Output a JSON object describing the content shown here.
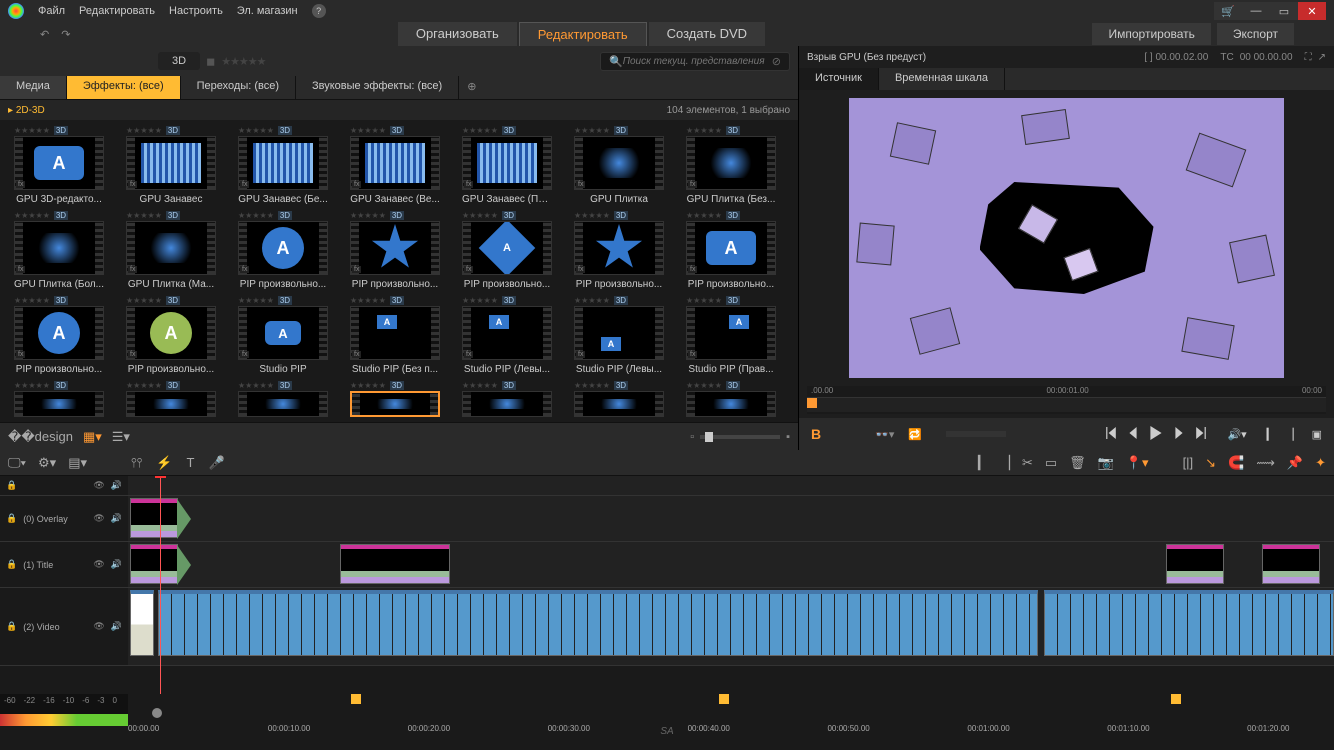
{
  "menu": {
    "file": "Файл",
    "edit": "Редактировать",
    "setup": "Настроить",
    "eshop": "Эл. магазин"
  },
  "modes": {
    "organize": "Организовать",
    "edit": "Редактировать",
    "createdvd": "Создать DVD"
  },
  "topRight": {
    "import": "Импортировать",
    "export": "Экспорт"
  },
  "leftPanel": {
    "label3d": "3D",
    "searchPlaceholder": "Поиск текущ. представления",
    "tabs": {
      "media": "Медиа",
      "effects": "Эффекты: (все)",
      "transitions": "Переходы: (все)",
      "sound": "Звуковые эффекты: (все)"
    },
    "category": "2D-3D",
    "countText": "104 элементов, 1 выбрано",
    "items": [
      [
        "GPU 3D-редакто...",
        "GPU Занавес",
        "GPU Занавес (Бе...",
        "GPU Занавес (Ве...",
        "GPU Занавес (По...",
        "GPU Плитка",
        "GPU Плитка (Без..."
      ],
      [
        "GPU Плитка (Бол...",
        "GPU Плитка (Ма...",
        "PIP произвольно...",
        "PIP произвольно...",
        "PIP произвольно...",
        "PIP произвольно...",
        "PIP произвольно..."
      ],
      [
        "PIP произвольно...",
        "PIP произвольно...",
        "Studio PIP",
        "Studio PIP (Без п...",
        "Studio PIP (Левы...",
        "Studio PIP (Левы...",
        "Studio PIP (Прав..."
      ]
    ],
    "badge3d": "3D"
  },
  "preview": {
    "title": "Взрыв GPU (Без предуст)",
    "timecodeLeft": "[ ] 00.00.02.00",
    "timecodeLabel": "TC",
    "timecodeRight": "00 00.00.00",
    "tabs": {
      "source": "Источник",
      "timeline": "Временная шкала"
    },
    "rulerStart": ".00.00",
    "rulerMid": "00:00:01.00",
    "rulerEnd": "00:00",
    "marker": "B"
  },
  "timeline": {
    "tracks": {
      "overlay": "(0) Overlay",
      "title": "(1) Title",
      "video": "(2) Video"
    },
    "dbLabels": [
      "-60",
      "-22",
      "-16",
      "-10",
      "-6",
      "-3",
      "0"
    ],
    "timestamps": [
      "00:00.00",
      "00:00:10.00",
      "00:00:20.00",
      "00:00:30.00",
      "00:00:40.00",
      "00:00:50.00",
      "00:01:00.00",
      "00:01:10.00",
      "00:01:20.00"
    ]
  },
  "footer": "SA"
}
